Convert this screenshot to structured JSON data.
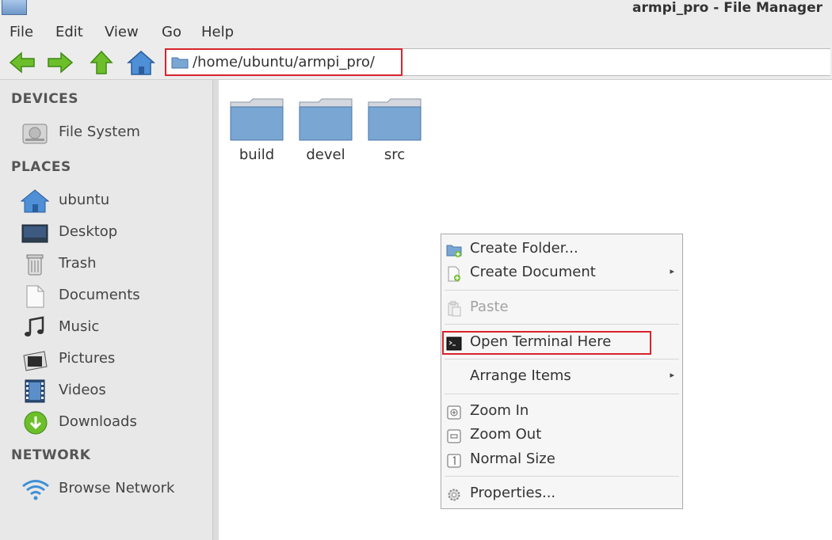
{
  "window": {
    "title": "armpi_pro - File Manager"
  },
  "menubar": {
    "items": [
      "File",
      "Edit",
      "View",
      "Go",
      "Help"
    ]
  },
  "toolbar": {
    "buttons": [
      "back-arrow-icon",
      "forward-arrow-icon",
      "up-arrow-icon",
      "home-icon"
    ],
    "location": "/home/ubuntu/armpi_pro/"
  },
  "sidebar": {
    "devices_heading": "DEVICES",
    "devices": [
      {
        "label": "File System",
        "icon": "drive-icon"
      }
    ],
    "places_heading": "PLACES",
    "places": [
      {
        "label": "ubuntu",
        "icon": "home-icon"
      },
      {
        "label": "Desktop",
        "icon": "desktop-icon"
      },
      {
        "label": "Trash",
        "icon": "trash-icon"
      },
      {
        "label": "Documents",
        "icon": "document-icon"
      },
      {
        "label": "Music",
        "icon": "music-icon"
      },
      {
        "label": "Pictures",
        "icon": "pictures-icon"
      },
      {
        "label": "Videos",
        "icon": "videos-icon"
      },
      {
        "label": "Downloads",
        "icon": "download-icon"
      }
    ],
    "network_heading": "NETWORK",
    "network": [
      {
        "label": "Browse Network",
        "icon": "wifi-icon"
      }
    ]
  },
  "content": {
    "folders": [
      "build",
      "devel",
      "src"
    ]
  },
  "context_menu": {
    "items": [
      {
        "label": "Create Folder...",
        "icon": "folder-add-icon"
      },
      {
        "label": "Create Document",
        "icon": "document-add-icon",
        "submenu": true
      },
      {
        "label": "Paste",
        "icon": "paste-icon",
        "disabled": true
      },
      {
        "label": "Open Terminal Here",
        "icon": "terminal-icon",
        "highlighted": true
      },
      {
        "label": "Arrange Items",
        "submenu": true
      },
      {
        "label": "Zoom In",
        "icon": "zoom-in-icon"
      },
      {
        "label": "Zoom Out",
        "icon": "zoom-out-icon"
      },
      {
        "label": "Normal Size",
        "icon": "zoom-normal-icon"
      },
      {
        "label": "Properties...",
        "icon": "gear-icon"
      }
    ]
  },
  "colors": {
    "highlight_box": "#d9232d",
    "sidebar_bg": "#e8e8e8",
    "folder_blue": "#7aa6d4",
    "arrow_green": "#6cbf2a"
  }
}
